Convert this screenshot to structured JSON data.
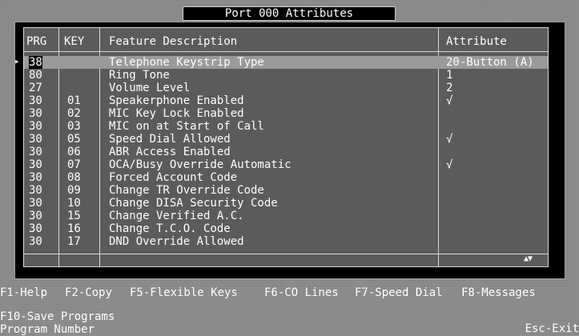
{
  "window": {
    "title": "Port 000 Attributes"
  },
  "table": {
    "headers": {
      "prg": "PRG",
      "key": "KEY",
      "feature": "Feature Description",
      "attribute": "Attribute"
    },
    "rows": [
      {
        "prg": "38",
        "key": "",
        "feature": "Telephone Keystrip Type",
        "attribute": "20-Button (A)"
      },
      {
        "prg": "80",
        "key": "",
        "feature": "Ring Tone",
        "attribute": "1"
      },
      {
        "prg": "27",
        "key": "",
        "feature": "Volume Level",
        "attribute": "2"
      },
      {
        "prg": "30",
        "key": "01",
        "feature": "Speakerphone Enabled",
        "attribute": "√"
      },
      {
        "prg": "30",
        "key": "02",
        "feature": "MIC Key Lock Enabled",
        "attribute": ""
      },
      {
        "prg": "30",
        "key": "03",
        "feature": "MIC on at Start of Call",
        "attribute": ""
      },
      {
        "prg": "30",
        "key": "05",
        "feature": "Speed Dial Allowed",
        "attribute": "√"
      },
      {
        "prg": "30",
        "key": "06",
        "feature": "ABR Access Enabled",
        "attribute": ""
      },
      {
        "prg": "30",
        "key": "07",
        "feature": "OCA/Busy Override Automatic",
        "attribute": "√"
      },
      {
        "prg": "30",
        "key": "08",
        "feature": "Forced Account Code",
        "attribute": ""
      },
      {
        "prg": "30",
        "key": "09",
        "feature": "Change TR Override Code",
        "attribute": ""
      },
      {
        "prg": "30",
        "key": "10",
        "feature": "Change DISA Security Code",
        "attribute": ""
      },
      {
        "prg": "30",
        "key": "15",
        "feature": "Change Verified A.C.",
        "attribute": ""
      },
      {
        "prg": "30",
        "key": "16",
        "feature": "Change T.C.O. Code",
        "attribute": ""
      },
      {
        "prg": "30",
        "key": "17",
        "feature": "DND Override Allowed",
        "attribute": ""
      }
    ],
    "selected_marker": "▸",
    "scroll_indicator": "▲▼"
  },
  "footer": {
    "keys_row1": [
      {
        "key": "F1",
        "label": "Help"
      },
      {
        "key": "F2",
        "label": "Copy"
      },
      {
        "key": "F5",
        "label": "Flexible Keys"
      },
      {
        "key": "F6",
        "label": "CO Lines"
      },
      {
        "key": "F7",
        "label": "Speed Dial"
      },
      {
        "key": "F8",
        "label": "Messages"
      }
    ],
    "keys_row2_left": {
      "key": "F10",
      "label": "Save Programs"
    },
    "keys_row2_right": {
      "key": "Esc",
      "label": "Exit"
    },
    "status": "Program Number"
  },
  "colors": {
    "background": "#8a8a8a",
    "panel": "#000000",
    "table_bg": "#5b5b5b",
    "selected_row": "#9a9a9a"
  }
}
